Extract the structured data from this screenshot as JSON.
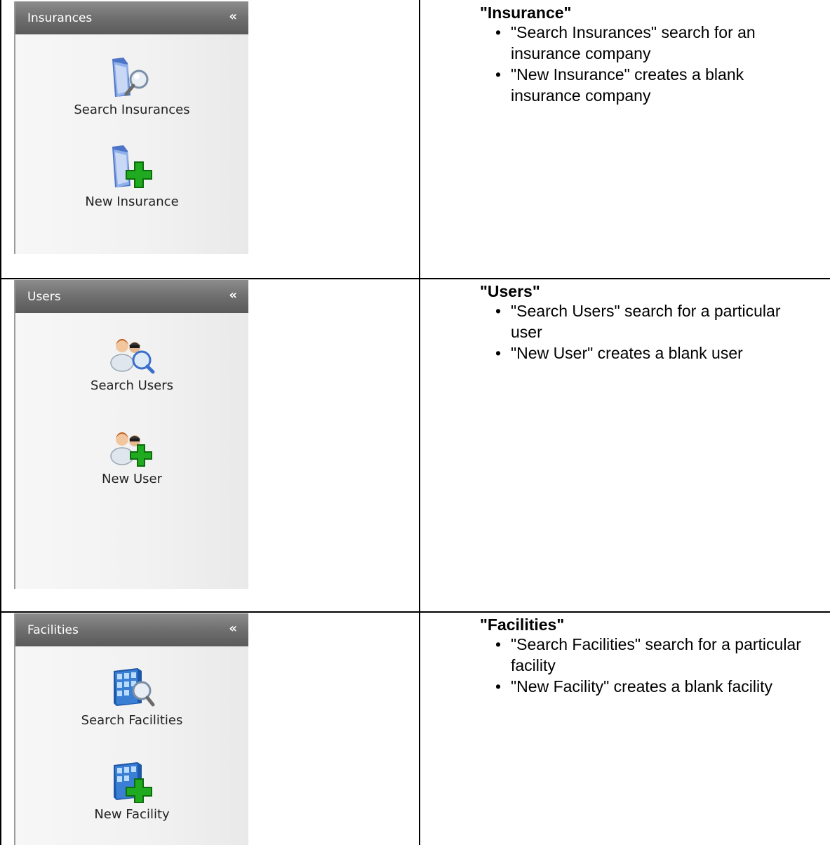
{
  "sections": [
    {
      "panel_title": "Insurances",
      "collapse_glyph": "«",
      "actions": [
        {
          "label": "Search Insurances",
          "icon": "folder-search-icon"
        },
        {
          "label": "New Insurance",
          "icon": "folder-add-icon"
        }
      ],
      "heading": "\"Insurance\"",
      "bullets": [
        "\"Search Insurances\" search for an insurance company",
        "\"New Insurance\" creates a blank insurance company"
      ]
    },
    {
      "panel_title": "Users",
      "collapse_glyph": "«",
      "actions": [
        {
          "label": "Search Users",
          "icon": "users-search-icon"
        },
        {
          "label": "New User",
          "icon": "users-add-icon"
        }
      ],
      "heading": "\"Users\"",
      "bullets": [
        "\"Search Users\" search for a particular user",
        "\"New User\" creates a blank user"
      ]
    },
    {
      "panel_title": "Facilities",
      "collapse_glyph": "«",
      "actions": [
        {
          "label": "Search Facilities",
          "icon": "building-search-icon"
        },
        {
          "label": "New Facility",
          "icon": "building-add-icon"
        }
      ],
      "heading": "\"Facilities\"",
      "bullets": [
        "\"Search Facilities\" search for a particular facility",
        "\"New Facility\" creates a blank facility"
      ]
    }
  ],
  "bullet_glyph": "•",
  "colors": {
    "header_dark": "#5a5a5a",
    "header_light": "#8c8c8c",
    "panel_bg": "#f1f1f1",
    "plus_green": "#1faa1f",
    "folder_blue": "#6f93d6"
  }
}
